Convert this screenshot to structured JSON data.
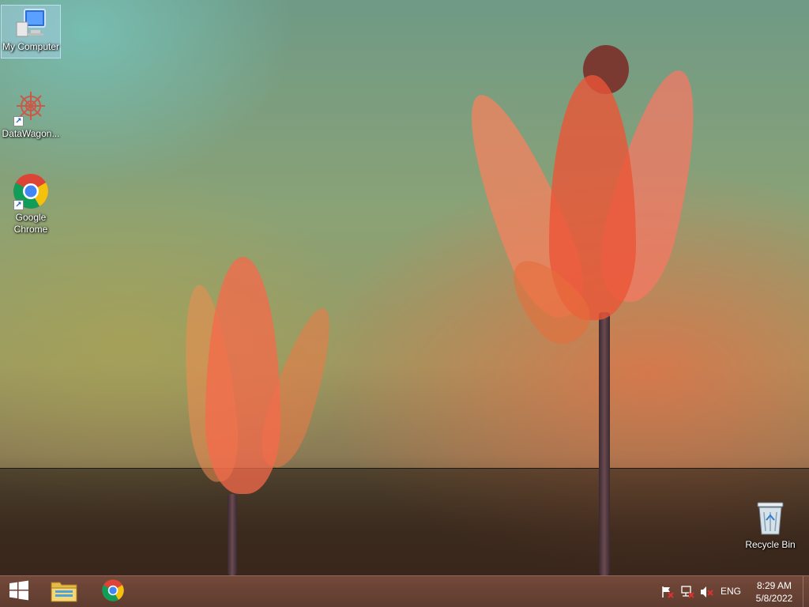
{
  "desktop": {
    "icons": [
      {
        "label": "My Computer",
        "icon": "computer-icon",
        "selected": true
      },
      {
        "label": "DataWagon...",
        "icon": "datawagon-app-icon",
        "shortcut": true
      },
      {
        "label": "Google Chrome",
        "icon": "chrome-icon",
        "shortcut": true
      },
      {
        "label": "Recycle Bin",
        "icon": "recycle-bin-icon"
      }
    ]
  },
  "taskbar": {
    "start": {
      "icon": "windows-logo-icon"
    },
    "pinned": [
      {
        "name": "File Explorer",
        "icon": "folder-icon"
      },
      {
        "name": "Google Chrome",
        "icon": "chrome-icon"
      }
    ],
    "tray": {
      "icons": [
        "action-center-flag-icon",
        "network-disconnected-icon",
        "volume-muted-icon"
      ],
      "language": "ENG",
      "time": "8:29 AM",
      "date": "5/8/2022"
    }
  },
  "colors": {
    "taskbar": "#6a4536",
    "chrome_red": "#db4437",
    "chrome_yellow": "#f4c20d",
    "chrome_green": "#0f9d58",
    "chrome_blue": "#4285f4",
    "flower": "#f07050"
  }
}
